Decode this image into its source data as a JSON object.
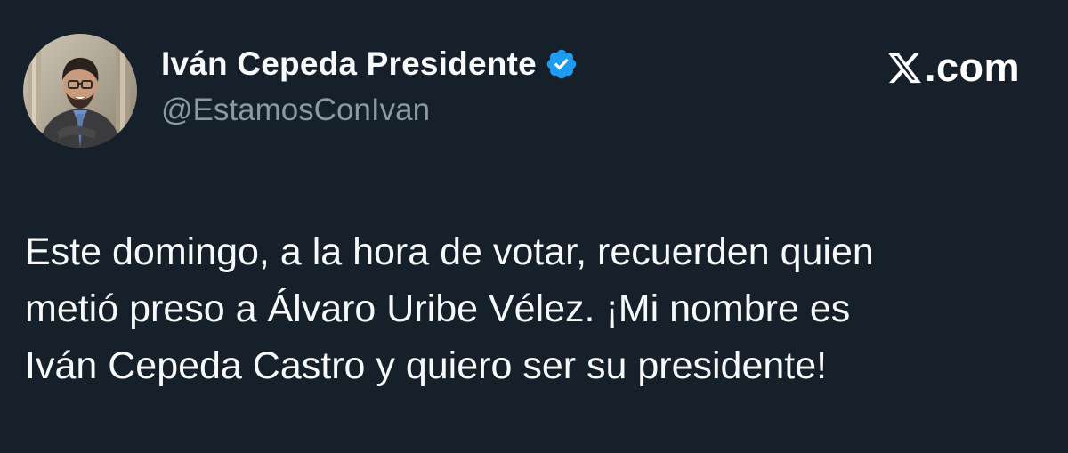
{
  "author": {
    "display_name": "Iván Cepeda Presidente",
    "handle": "@EstamosConIvan",
    "verified": true,
    "verified_icon": "verified-badge-icon",
    "avatar": "profile-photo"
  },
  "brand": {
    "logo_icon": "x-logo-icon",
    "text": ".com"
  },
  "tweet": {
    "lines": [
      "Este domingo, a la hora de votar, recuerden quien",
      "metió preso a Álvaro Uribe Vélez. ¡Mi nombre es",
      "Iván Cepeda Castro y quiero ser su presidente!"
    ]
  },
  "colors": {
    "background": "#15202b",
    "text": "#f7f9f9",
    "secondary_text": "#8b98a5",
    "verified_blue": "#1d9bf0"
  }
}
